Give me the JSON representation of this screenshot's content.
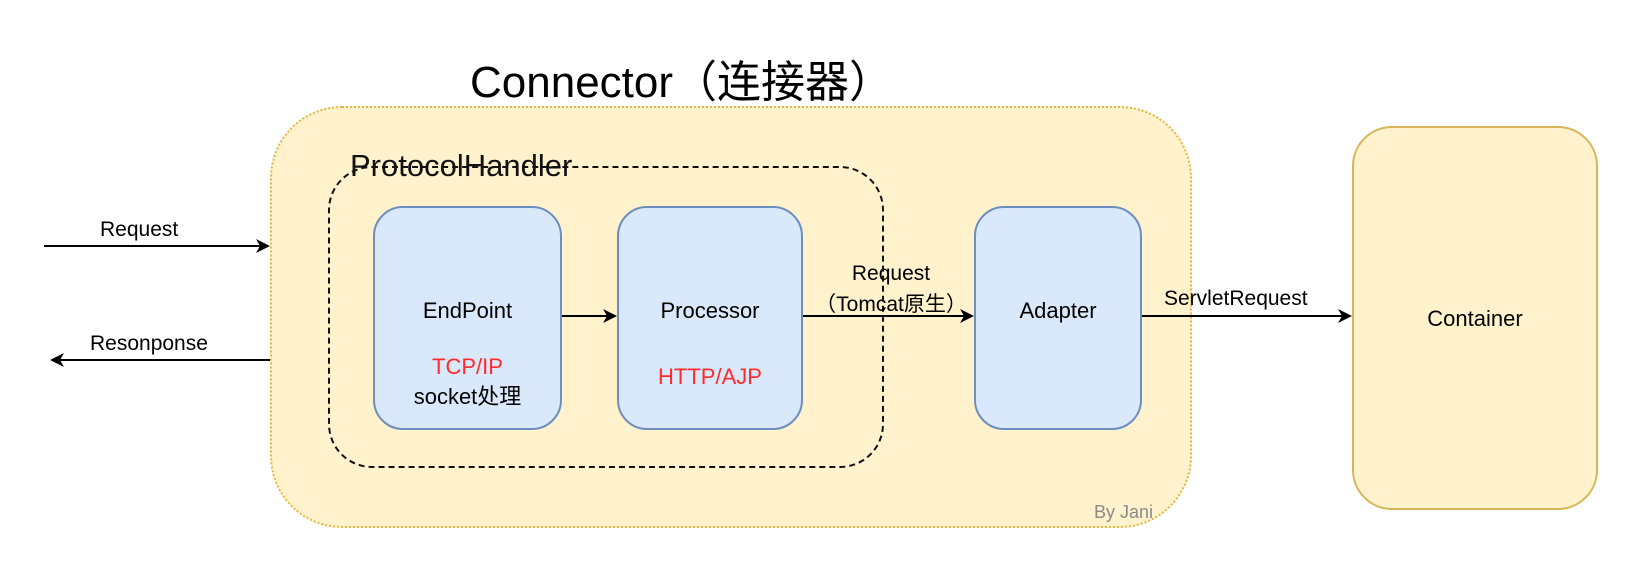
{
  "title": "Connector（连接器）",
  "protocol_handler": {
    "label": "ProtocolHandler"
  },
  "nodes": {
    "endpoint": {
      "name": "EndPoint",
      "sub_red": "TCP/IP",
      "sub_black": "socket处理"
    },
    "processor": {
      "name": "Processor",
      "sub_red": "HTTP/AJP"
    },
    "adapter": {
      "name": "Adapter"
    },
    "container": {
      "name": "Container"
    }
  },
  "edges": {
    "request_in": "Request",
    "response_out": "Resonponse",
    "processor_to_adapter_line1": "Request",
    "processor_to_adapter_line2": "（Tomcat原生）",
    "adapter_to_container": "ServletRequest"
  },
  "watermark": "By Jani",
  "colors": {
    "connector_fill": "#fff2cc",
    "connector_border": "#e0b84a",
    "node_fill": "#dae8fc",
    "node_border": "#6c8ebf",
    "container_border": "#d6b656",
    "protocol_text": "#ff2b2b"
  }
}
